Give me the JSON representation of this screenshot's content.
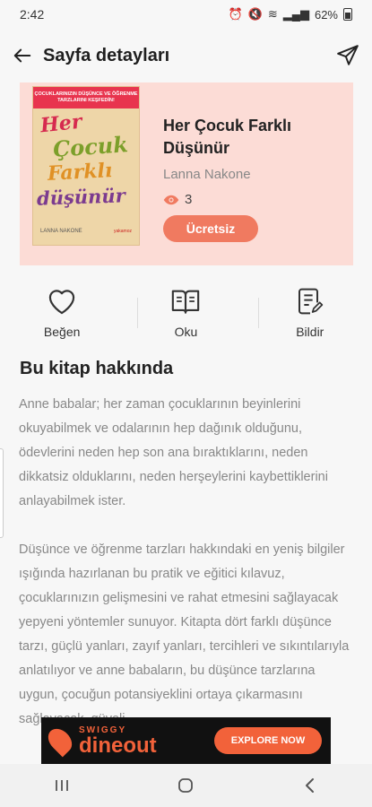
{
  "status": {
    "time": "2:42",
    "battery": "62%"
  },
  "appbar": {
    "title": "Sayfa detayları"
  },
  "book": {
    "title": "Her Çocuk Farklı Düşünür",
    "author": "Lanna Nakone",
    "views": "3",
    "price_label": "Ücretsiz",
    "cover": {
      "tagline": "ÇOCUKLARINIZIN DÜŞÜNCE VE ÖĞRENME TARZLARINI KEŞFEDİN!",
      "line1": "Her",
      "line2": "Çocuk",
      "line3": "Farklı",
      "line4": "düşünür",
      "author": "LANNA NAKONE",
      "publisher": "yakamoz"
    }
  },
  "actions": {
    "like": "Beğen",
    "read": "Oku",
    "report": "Bildir"
  },
  "about": {
    "heading": "Bu kitap hakkında",
    "p1": "Anne babalar; her zaman çocuklarının beyinlerini okuyabilmek ve odalarının hep dağınık olduğunu, ödevlerini neden hep son ana bıraktıklarını, neden dikkatsiz olduklarını, neden herşeylerini kaybettiklerini anlayabilmek ister.",
    "p2": "Düşünce ve öğrenme tarzları hakkındaki en yeniş bilgiler ışığında hazırlanan bu pratik ve eğitici kılavuz, çocuklarınızın gelişmesini ve rahat etmesini sağlayacak yepyeni yöntemler sunuyor. Kitapta dört farklı düşünce tarzı, güçlü yanları, zayıf yanları, tercihleri ve sıkıntılarıyla anlatılıyor ve anne babaların, bu düşünce tarzlarına uygun, çocuğun potansiyeklini ortaya çıkarmasını sağlayacak, güveli,"
  },
  "ad": {
    "brand_top": "SWIGGY",
    "brand_main": "dineout",
    "cta": "EXPLORE NOW"
  },
  "colors": {
    "accent": "#f07a60",
    "card_bg": "#fcdcd6",
    "ad_orange": "#f2623a"
  }
}
